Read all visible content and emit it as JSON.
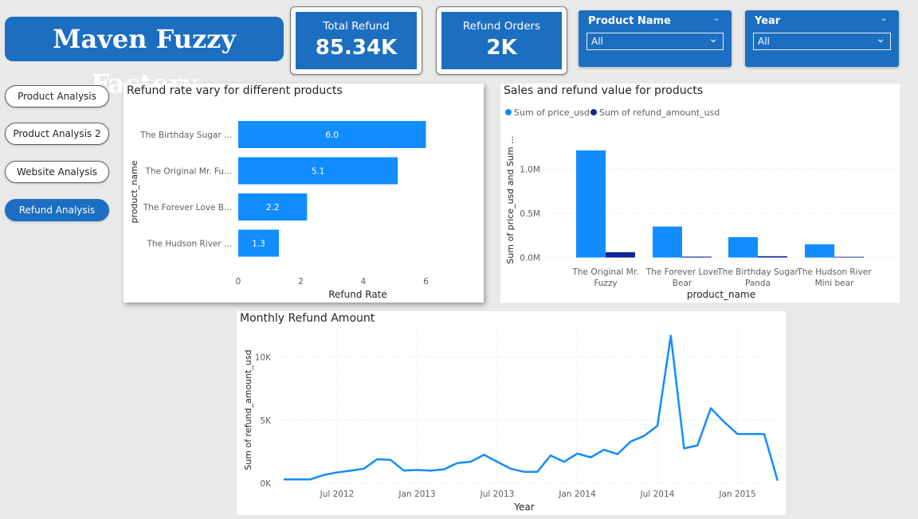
{
  "header": {
    "title": "Maven Fuzzy Factory"
  },
  "kpis": [
    {
      "label": "Total Refund",
      "value": "85.34K"
    },
    {
      "label": "Refund Orders",
      "value": "2K"
    }
  ],
  "slicers": [
    {
      "title": "Product Name",
      "value": "All"
    },
    {
      "title": "Year",
      "value": "All"
    }
  ],
  "nav": [
    {
      "label": "Product Analysis",
      "active": false
    },
    {
      "label": "Product Analysis 2",
      "active": false
    },
    {
      "label": "Website Analysis",
      "active": false
    },
    {
      "label": "Refund Analysis",
      "active": true
    }
  ],
  "colors": {
    "primary": "#1c6ec0",
    "bar": "#118dff",
    "dark_series": "#12239e"
  },
  "chart_data": [
    {
      "type": "bar",
      "orientation": "horizontal",
      "title": "Refund rate vary for different products",
      "xlabel": "Refund Rate",
      "ylabel": "product_name",
      "categories": [
        "The Birthday Sugar ...",
        "The Original Mr. Fu...",
        "The Forever Love B...",
        "The Hudson River ..."
      ],
      "values": [
        6.0,
        5.1,
        2.2,
        1.3
      ],
      "data_labels": [
        "6.0",
        "5.1",
        "2.2",
        "1.3"
      ],
      "xticks": [
        "0",
        "2",
        "4",
        "6"
      ],
      "xlim": [
        0,
        6.6
      ]
    },
    {
      "type": "bar",
      "title": "Sales and refund value for products",
      "xlabel": "product_name",
      "ylabel": "Sum of price_usd and Sum ...",
      "categories": [
        "The Original Mr. Fuzzy",
        "The Forever Love Bear",
        "The Birthday Sugar Panda",
        "The Hudson River Mini bear"
      ],
      "series": [
        {
          "name": "Sum of price_usd",
          "values": [
            1.21,
            0.35,
            0.23,
            0.15
          ]
        },
        {
          "name": "Sum of refund_amount_usd",
          "values": [
            0.06,
            0.01,
            0.015,
            0.008
          ]
        }
      ],
      "yticks": [
        "0.0M",
        "0.5M",
        "1.0M"
      ],
      "ylim": [
        0,
        1.3
      ],
      "legend": "top-left"
    },
    {
      "type": "line",
      "title": "Monthly Refund Amount",
      "xlabel": "Year",
      "ylabel": "Sum of refund_amount_usd",
      "x": [
        "2012-03",
        "2012-04",
        "2012-05",
        "2012-06",
        "2012-07",
        "2012-08",
        "2012-09",
        "2012-10",
        "2012-11",
        "2012-12",
        "2013-01",
        "2013-02",
        "2013-03",
        "2013-04",
        "2013-05",
        "2013-06",
        "2013-07",
        "2013-08",
        "2013-09",
        "2013-10",
        "2013-11",
        "2013-12",
        "2014-01",
        "2014-02",
        "2014-03",
        "2014-04",
        "2014-05",
        "2014-06",
        "2014-07",
        "2014-08",
        "2014-09",
        "2014-10",
        "2014-11",
        "2014-12",
        "2015-01",
        "2015-02",
        "2015-03",
        "2015-04"
      ],
      "y": [
        300,
        300,
        300,
        650,
        850,
        1000,
        1150,
        1900,
        1850,
        1000,
        1050,
        1000,
        1100,
        1600,
        1700,
        2250,
        1700,
        1150,
        900,
        900,
        2200,
        1700,
        2350,
        2050,
        2650,
        2300,
        3300,
        3750,
        4550,
        11700,
        2750,
        3000,
        5950,
        4850,
        3900,
        3900,
        3900,
        200
      ],
      "xticks": [
        "Jul 2012",
        "Jan 2013",
        "Jul 2013",
        "Jan 2014",
        "Jul 2014",
        "Jan 2015"
      ],
      "yticks": [
        "0K",
        "5K",
        "10K"
      ],
      "ylim": [
        0,
        12500
      ]
    }
  ]
}
